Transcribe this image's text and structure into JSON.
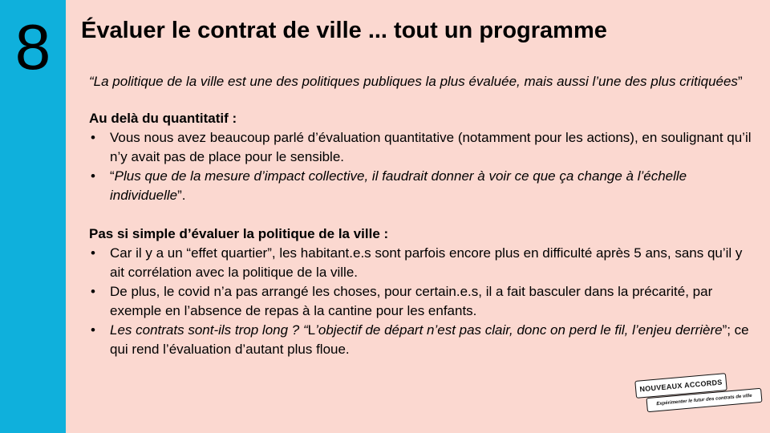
{
  "slide": {
    "number": "8",
    "title": "Évaluer le contrat de ville ... tout un programme"
  },
  "quote": {
    "text": "“La politique de la ville est une des politiques publiques la plus évaluée, mais aussi l’une des plus critiquées",
    "close": "”"
  },
  "section1": {
    "heading": "Au delà du quantitatif :",
    "items": [
      {
        "text": "Vous nous avez beaucoup parlé d’évaluation quantitative (notamment pour les actions), en soulignant qu’il n’y avait pas de place pour le sensible."
      },
      {
        "open": "“",
        "italic": "Plus que de la mesure d’impact collective, il faudrait donner à voir ce que ça change à l’échelle individuelle",
        "close": "”."
      }
    ]
  },
  "section2": {
    "heading": "Pas si simple d’évaluer la politique de la ville :",
    "items": [
      {
        "text": "Car il y a un “effet quartier”, les habitant.e.s sont parfois encore plus en difficulté après 5 ans, sans qu’il y ait corrélation avec la politique de la ville."
      },
      {
        "text": "De plus, le covid n’a pas arrangé les choses, pour certain.e.s, il a fait basculer dans la précarité, par exemple en l’absence de repas à la cantine pour les enfants."
      },
      {
        "italic1": "Les contrats sont-ils trop long ? “",
        "plain1": "L",
        "italic2": "’objectif de départ n’est pas clair, donc on perd le fil, l’enjeu derrière",
        "plain2": "”; ce qui rend l’évaluation d’autant plus floue."
      }
    ]
  },
  "logo": {
    "name": "NOUVEAUX ACCORDS",
    "tagline": "Expérimenter le futur des contrats de ville"
  },
  "colors": {
    "background": "#fbd8d0",
    "sidebar": "#0fb0dc"
  }
}
